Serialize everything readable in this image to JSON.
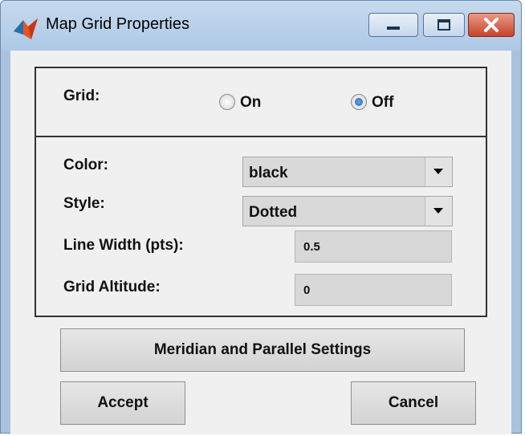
{
  "window": {
    "title": "Map Grid Properties"
  },
  "grid": {
    "label": "Grid:",
    "options": [
      {
        "label": "On",
        "selected": false
      },
      {
        "label": "Off",
        "selected": true
      }
    ]
  },
  "properties": {
    "color": {
      "label": "Color:",
      "value": "black"
    },
    "style": {
      "label": "Style:",
      "value": "Dotted"
    },
    "line_width": {
      "label": "Line Width (pts):",
      "value": "0.5"
    },
    "altitude": {
      "label": "Grid Altitude:",
      "value": "0"
    }
  },
  "buttons": {
    "meridian": "Meridian and Parallel Settings",
    "accept": "Accept",
    "cancel": "Cancel"
  },
  "colors": {
    "titlebar": "#adc8e6",
    "client": "#f0f0f0",
    "close": "#c6432b"
  }
}
